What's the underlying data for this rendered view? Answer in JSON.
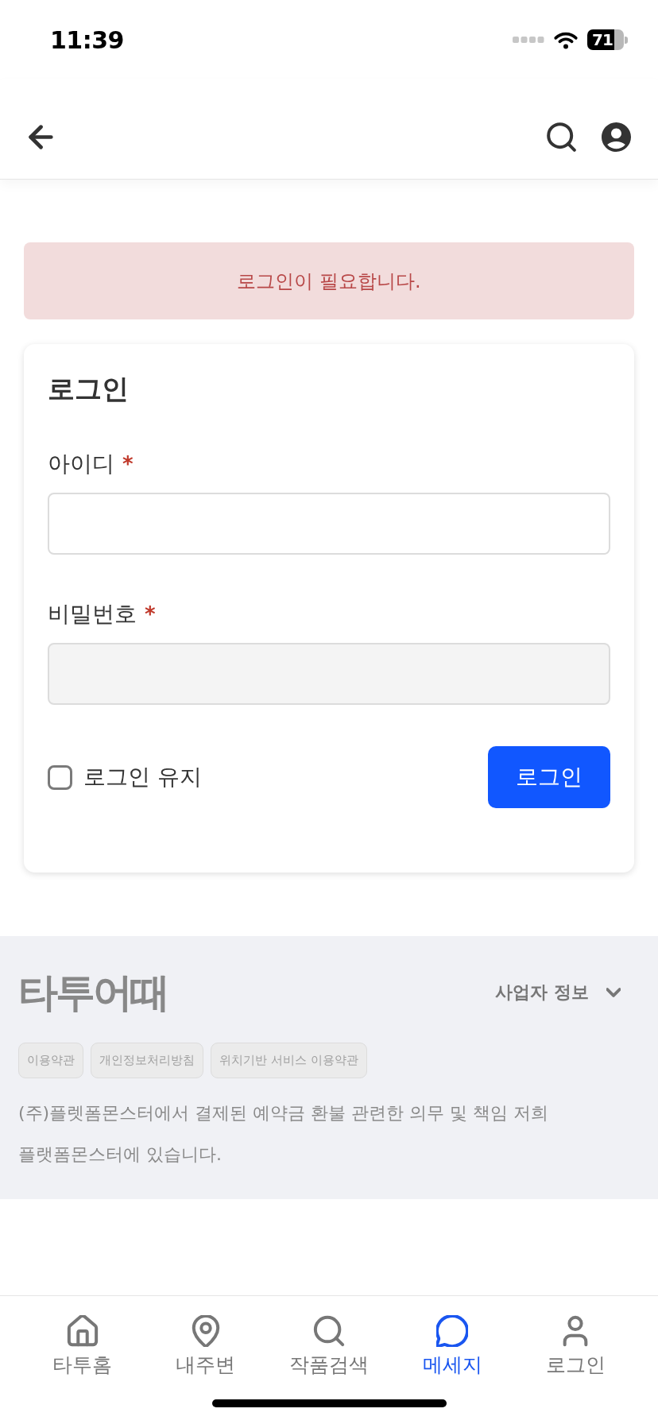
{
  "status_bar": {
    "time": "11:39",
    "battery": "71"
  },
  "alert": {
    "message": "로그인이 필요합니다."
  },
  "login_card": {
    "title": "로그인",
    "fields": [
      {
        "label": "아이디",
        "required_mark": "*",
        "kind": "text"
      },
      {
        "label": "비밀번호",
        "required_mark": "*",
        "kind": "password"
      }
    ],
    "remember": {
      "label": "로그인 유지",
      "checked": false
    },
    "submit": "로그인"
  },
  "footer": {
    "logo": "타투어때",
    "business_info": {
      "label": "사업자 정보",
      "expanded": false
    },
    "links": [
      "이용약관",
      "개인정보처리방침",
      "위치기반 서비스 이용약관"
    ],
    "notice": "(주)플렛폼몬스터에서 결제된 예약금 환불 관련한 의무 및 책임 저희 플랫폼몬스터에 있습니다."
  },
  "tab_bar": {
    "items": [
      {
        "label": "타투홈",
        "selected": false
      },
      {
        "label": "내주변",
        "selected": false
      },
      {
        "label": "작품검색",
        "selected": false
      },
      {
        "label": "메세지",
        "selected": true
      },
      {
        "label": "로그인",
        "selected": false
      }
    ]
  }
}
